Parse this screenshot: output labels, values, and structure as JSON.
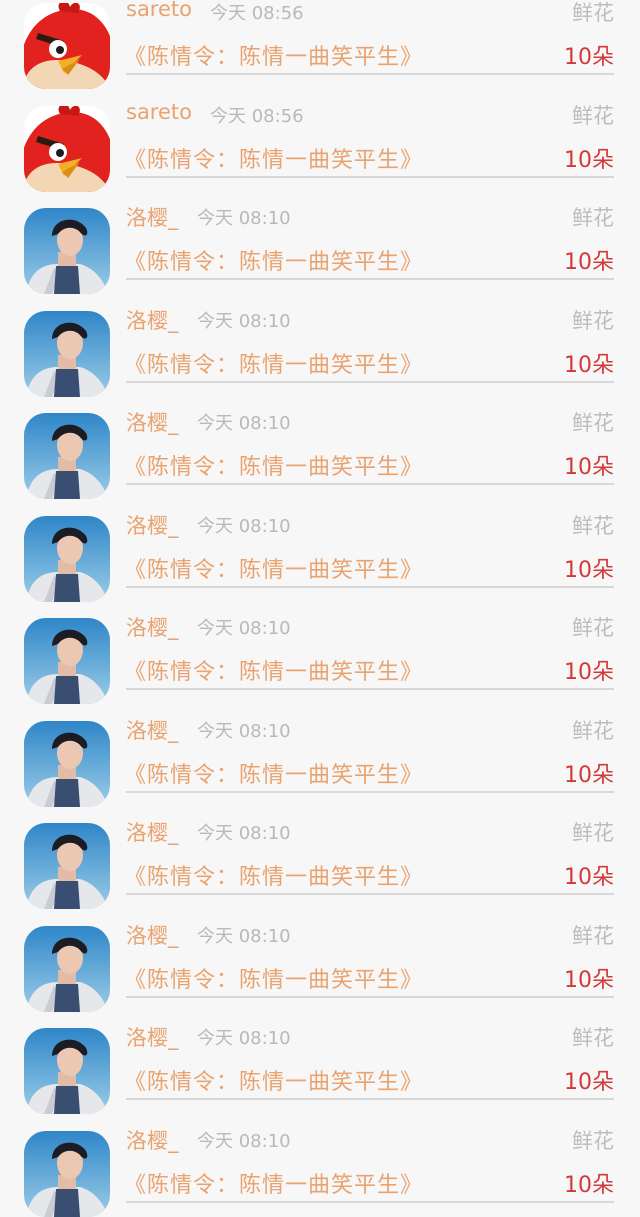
{
  "list": {
    "items": [
      {
        "avatar": "angry-bird",
        "name": "sareto",
        "time": "今天 08:56",
        "type": "鲜花",
        "title": "《陈情令：陈情一曲笑平生》",
        "amount": "10朵"
      },
      {
        "avatar": "angry-bird",
        "name": "sareto",
        "time": "今天 08:56",
        "type": "鲜花",
        "title": "《陈情令：陈情一曲笑平生》",
        "amount": "10朵"
      },
      {
        "avatar": "man-portrait",
        "name": "洛樱_",
        "time": "今天 08:10",
        "type": "鲜花",
        "title": "《陈情令：陈情一曲笑平生》",
        "amount": "10朵"
      },
      {
        "avatar": "man-portrait",
        "name": "洛樱_",
        "time": "今天 08:10",
        "type": "鲜花",
        "title": "《陈情令：陈情一曲笑平生》",
        "amount": "10朵"
      },
      {
        "avatar": "man-portrait",
        "name": "洛樱_",
        "time": "今天 08:10",
        "type": "鲜花",
        "title": "《陈情令：陈情一曲笑平生》",
        "amount": "10朵"
      },
      {
        "avatar": "man-portrait",
        "name": "洛樱_",
        "time": "今天 08:10",
        "type": "鲜花",
        "title": "《陈情令：陈情一曲笑平生》",
        "amount": "10朵"
      },
      {
        "avatar": "man-portrait",
        "name": "洛樱_",
        "time": "今天 08:10",
        "type": "鲜花",
        "title": "《陈情令：陈情一曲笑平生》",
        "amount": "10朵"
      },
      {
        "avatar": "man-portrait",
        "name": "洛樱_",
        "time": "今天 08:10",
        "type": "鲜花",
        "title": "《陈情令：陈情一曲笑平生》",
        "amount": "10朵"
      },
      {
        "avatar": "man-portrait",
        "name": "洛樱_",
        "time": "今天 08:10",
        "type": "鲜花",
        "title": "《陈情令：陈情一曲笑平生》",
        "amount": "10朵"
      },
      {
        "avatar": "man-portrait",
        "name": "洛樱_",
        "time": "今天 08:10",
        "type": "鲜花",
        "title": "《陈情令：陈情一曲笑平生》",
        "amount": "10朵"
      },
      {
        "avatar": "man-portrait",
        "name": "洛樱_",
        "time": "今天 08:10",
        "type": "鲜花",
        "title": "《陈情令：陈情一曲笑平生》",
        "amount": "10朵"
      },
      {
        "avatar": "man-portrait",
        "name": "洛樱_",
        "time": "今天 08:10",
        "type": "鲜花",
        "title": "《陈情令：陈情一曲笑平生》",
        "amount": "10朵"
      }
    ]
  },
  "colors": {
    "name": "#e8a36f",
    "title": "#e8a36f",
    "time": "#b9b9b9",
    "type": "#bdbdbd",
    "amount": "#d23a3a",
    "divider": "#d7d7d7",
    "background": "#f8f7f8"
  }
}
